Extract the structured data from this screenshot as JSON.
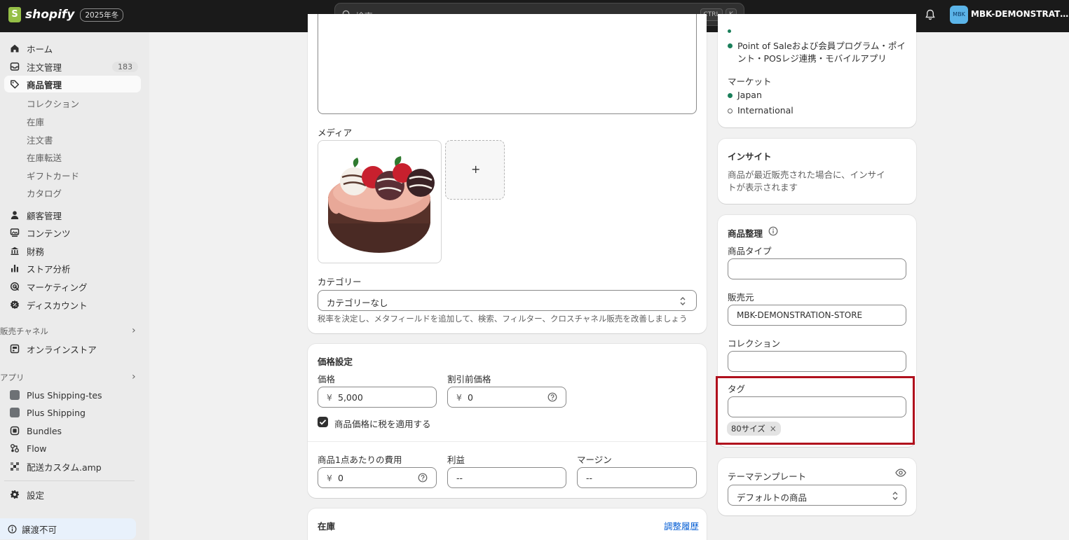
{
  "topbar": {
    "logo_text": "shopify",
    "badge": "2025年冬",
    "search_placeholder": "検索",
    "kbd_ctrl": "CTRL",
    "kbd_k": "K",
    "store_avatar": "MBK",
    "store_name": "MBK-DEMONSTRATION-..."
  },
  "sidebar": {
    "home": "ホーム",
    "orders": "注文管理",
    "orders_count": "183",
    "products": "商品管理",
    "product_subs": [
      "コレクション",
      "在庫",
      "注文書",
      "在庫転送",
      "ギフトカード",
      "カタログ"
    ],
    "customers": "顧客管理",
    "content": "コンテンツ",
    "finance": "財務",
    "analytics": "ストア分析",
    "marketing": "マーケティング",
    "discounts": "ディスカウント",
    "sales_channels": "販売チャネル",
    "online_store": "オンラインストア",
    "apps": "アプリ",
    "app_items": [
      "Plus Shipping-tes",
      "Plus Shipping",
      "Bundles",
      "Flow",
      "配送カスタム.amp"
    ],
    "settings": "設定",
    "notice": "譲渡不可"
  },
  "main": {
    "media_label": "メディア",
    "add_media": "+",
    "category_label": "カテゴリー",
    "category_value": "カテゴリーなし",
    "category_help": "税率を決定し、メタフィールドを追加して、検索、フィルター、クロスチャネル販売を改善しましょう",
    "pricing": {
      "title": "価格設定",
      "price_label": "価格",
      "currency": "¥",
      "price_value": "5,000",
      "compare_label": "割引前価格",
      "compare_value": "0",
      "tax_checkbox_label": "商品価格に税を適用する",
      "cost_label": "商品1点あたりの費用",
      "cost_value": "0",
      "profit_label": "利益",
      "profit_value": "--",
      "margin_label": "マージン",
      "margin_value": "--"
    },
    "inventory": {
      "title": "在庫",
      "history_link": "調整履歴"
    }
  },
  "right": {
    "publishing": {
      "pos_channel": "Point of Saleおよび会員プログラム・ポイント・POSレジ連携・モバイルアプリ",
      "markets_label": "マーケット",
      "markets": [
        "Japan",
        "International"
      ]
    },
    "insights": {
      "title": "インサイト",
      "text": "商品が最近販売された場合に、インサイトが表示されます"
    },
    "organization": {
      "title": "商品整理",
      "type_label": "商品タイプ",
      "type_value": "",
      "vendor_label": "販売元",
      "vendor_value": "MBK-DEMONSTRATION-STORE",
      "collection_label": "コレクション",
      "collection_value": "",
      "tags_label": "タグ",
      "tags_value": "",
      "tags": [
        "80サイズ"
      ]
    },
    "theme": {
      "title": "テーマテンプレート",
      "value": "デフォルトの商品"
    }
  },
  "colors": {
    "topbar": "#1a1a1a",
    "accent_green": "#1a7f5a",
    "highlight_border": "#b0101d",
    "link": "#005bd3"
  }
}
